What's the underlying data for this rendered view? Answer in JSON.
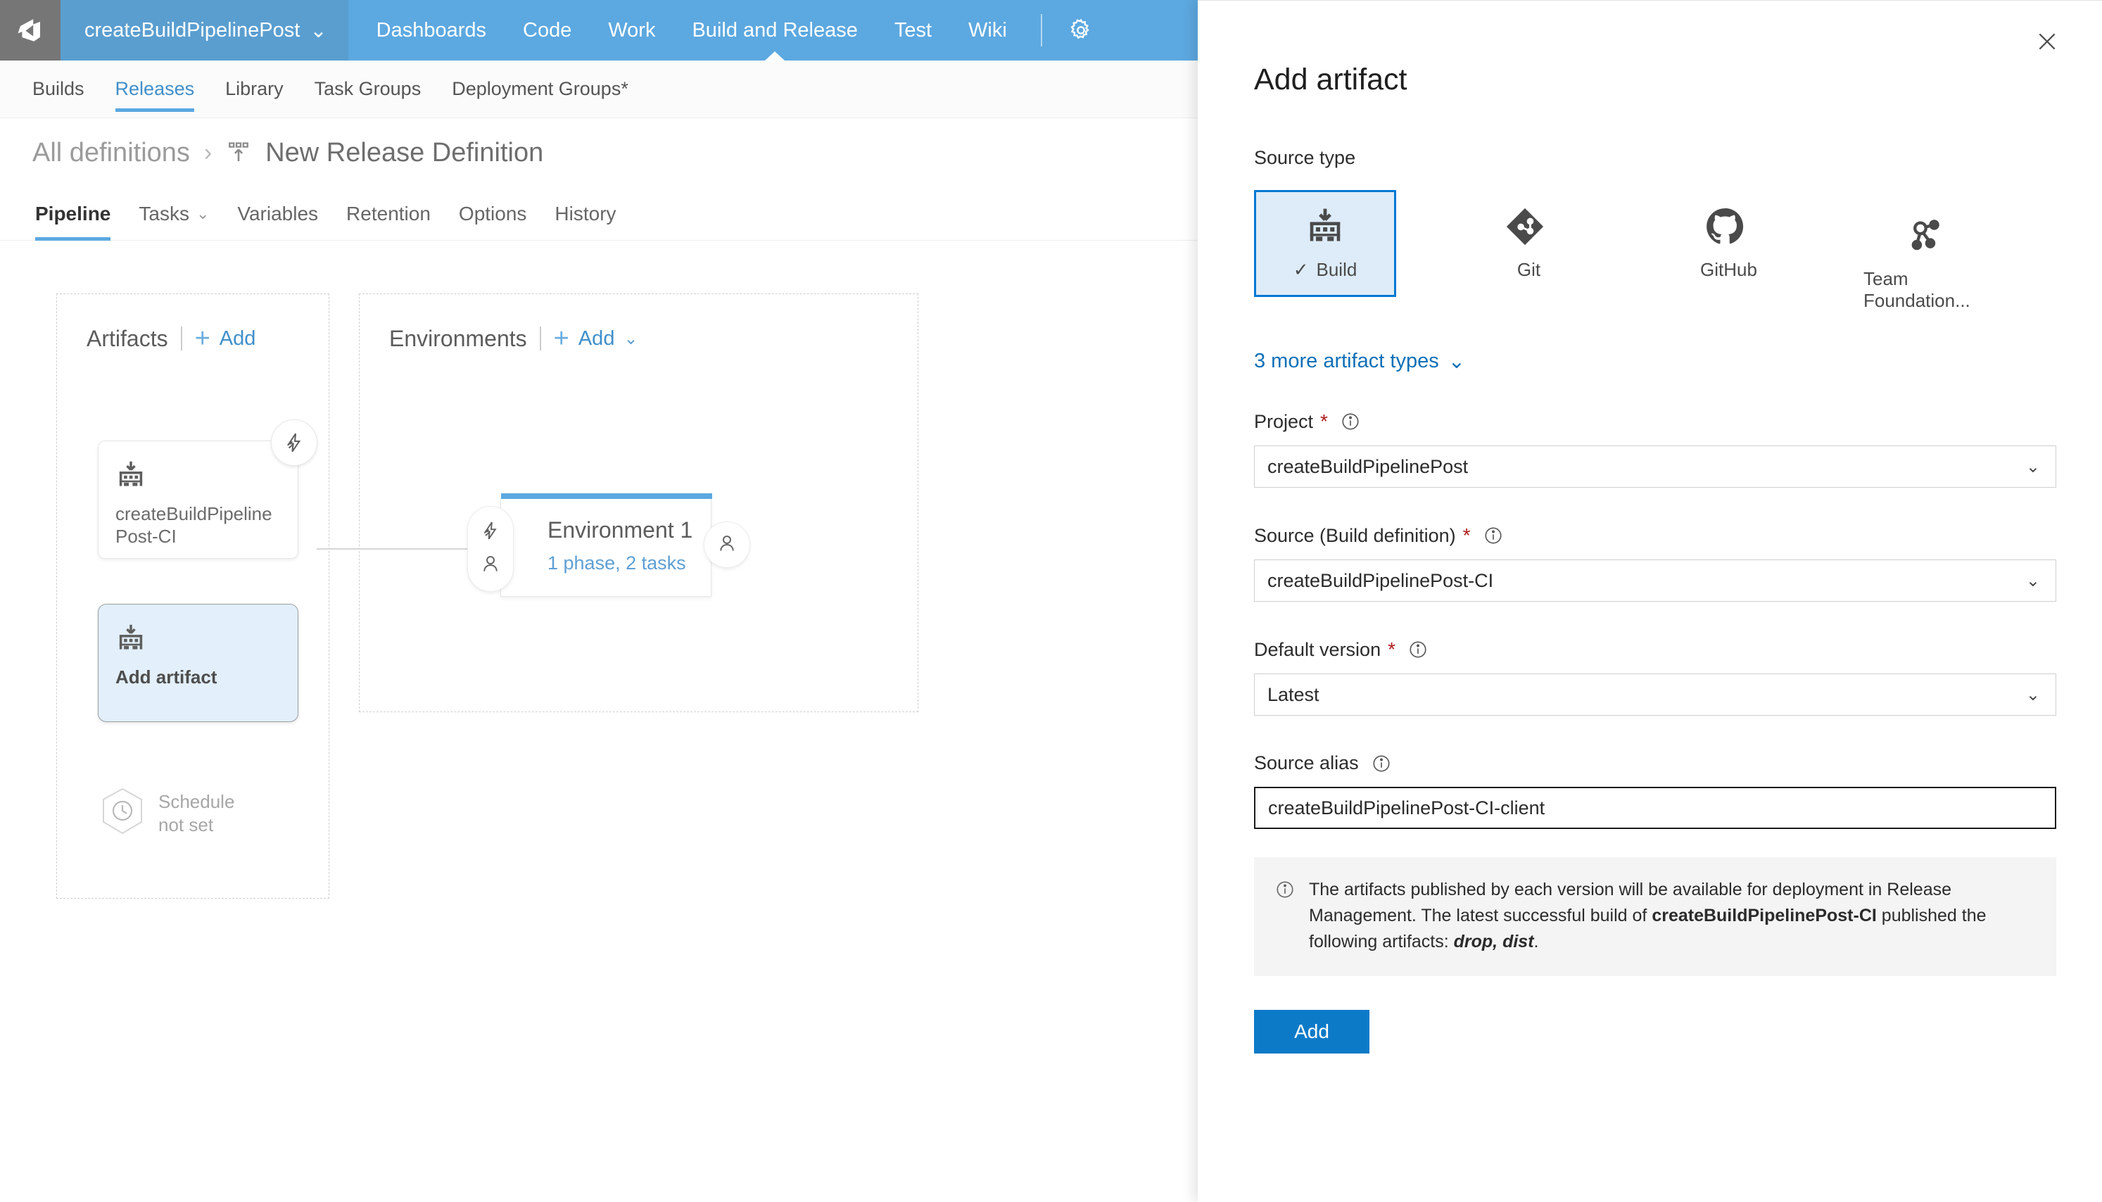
{
  "topnav": {
    "logo_icon": "azure-devops-logo-icon",
    "project": {
      "name": "createBuildPipelinePost",
      "chevron": "⌄"
    },
    "links": [
      {
        "label": "Dashboards",
        "active": false
      },
      {
        "label": "Code",
        "active": false
      },
      {
        "label": "Work",
        "active": false
      },
      {
        "label": "Build and Release",
        "active": true
      },
      {
        "label": "Test",
        "active": false
      },
      {
        "label": "Wiki",
        "active": false
      }
    ],
    "gear_icon": "gear-icon"
  },
  "subnav": {
    "items": [
      {
        "label": "Builds",
        "active": false
      },
      {
        "label": "Releases",
        "active": true
      },
      {
        "label": "Library",
        "active": false
      },
      {
        "label": "Task Groups",
        "active": false
      },
      {
        "label": "Deployment Groups*",
        "active": false
      }
    ]
  },
  "breadcrumb": {
    "root": "All definitions",
    "separator": "›",
    "icon": "release-definition-icon",
    "title": "New Release Definition"
  },
  "page_tabs": [
    {
      "label": "Pipeline",
      "active": true,
      "chevron": ""
    },
    {
      "label": "Tasks",
      "active": false,
      "chevron": "⌄"
    },
    {
      "label": "Variables",
      "active": false,
      "chevron": ""
    },
    {
      "label": "Retention",
      "active": false,
      "chevron": ""
    },
    {
      "label": "Options",
      "active": false,
      "chevron": ""
    },
    {
      "label": "History",
      "active": false,
      "chevron": ""
    }
  ],
  "artifacts": {
    "title": "Artifacts",
    "add_label": "Add",
    "add_plus": "+",
    "card": {
      "label": "createBuildPipelinePost-CI",
      "icon": "build-artifact-icon",
      "badge_icon": "lightning-bolt-icon"
    },
    "add_card": {
      "label": "Add artifact",
      "icon": "build-artifact-icon"
    },
    "schedule": {
      "icon": "clock-icon",
      "line1": "Schedule",
      "line2": "not set"
    }
  },
  "environments": {
    "title": "Environments",
    "add_label": "Add",
    "add_plus": "+",
    "add_chevron": "⌄",
    "node": {
      "name": "Environment 1",
      "subtitle": "1 phase, 2 tasks",
      "pre_icons": [
        "lightning-bolt-icon",
        "person-icon"
      ],
      "post_icon": "person-icon"
    }
  },
  "panel": {
    "title": "Add artifact",
    "close_icon": "close-icon",
    "source_type_label": "Source type",
    "source_types": [
      {
        "label": "Build",
        "icon": "build-artifact-icon",
        "selected": true,
        "check": "✓"
      },
      {
        "label": "Git",
        "icon": "git-icon",
        "selected": false,
        "check": ""
      },
      {
        "label": "GitHub",
        "icon": "github-icon",
        "selected": false,
        "check": ""
      },
      {
        "label": "Team Foundation...",
        "icon": "team-foundation-version-control-icon",
        "selected": false,
        "check": ""
      }
    ],
    "more_types_label": "3 more artifact types",
    "more_types_chevron": "⌄",
    "fields": [
      {
        "label": "Project",
        "required": "*",
        "info_icon": "info-icon",
        "type": "select",
        "value": "createBuildPipelinePost",
        "chevron": "⌄"
      },
      {
        "label": "Source (Build definition)",
        "required": "*",
        "info_icon": "info-icon",
        "type": "select",
        "value": "createBuildPipelinePost-CI",
        "chevron": "⌄"
      },
      {
        "label": "Default version",
        "required": "*",
        "info_icon": "info-icon",
        "type": "select",
        "value": "Latest",
        "chevron": "⌄"
      },
      {
        "label": "Source alias",
        "required": "",
        "info_icon": "info-icon",
        "type": "text",
        "value": "createBuildPipelinePost-CI-client",
        "chevron": ""
      }
    ],
    "notice": {
      "icon": "info-icon",
      "part1": "The artifacts published by each version will be available for deployment in Release Management. The latest successful build of ",
      "bold1": "createBuildPipelinePost-CI",
      "part2": " published the following artifacts: ",
      "italic1": "drop, dist",
      "part3": "."
    },
    "add_button": "Add"
  },
  "colors": {
    "brand_blue": "#5ca8e0",
    "accent_blue": "#0078d4",
    "button_blue": "#0d7ac8",
    "selected_tile_bg": "#deecf9",
    "link_blue": "#0f70b7"
  }
}
